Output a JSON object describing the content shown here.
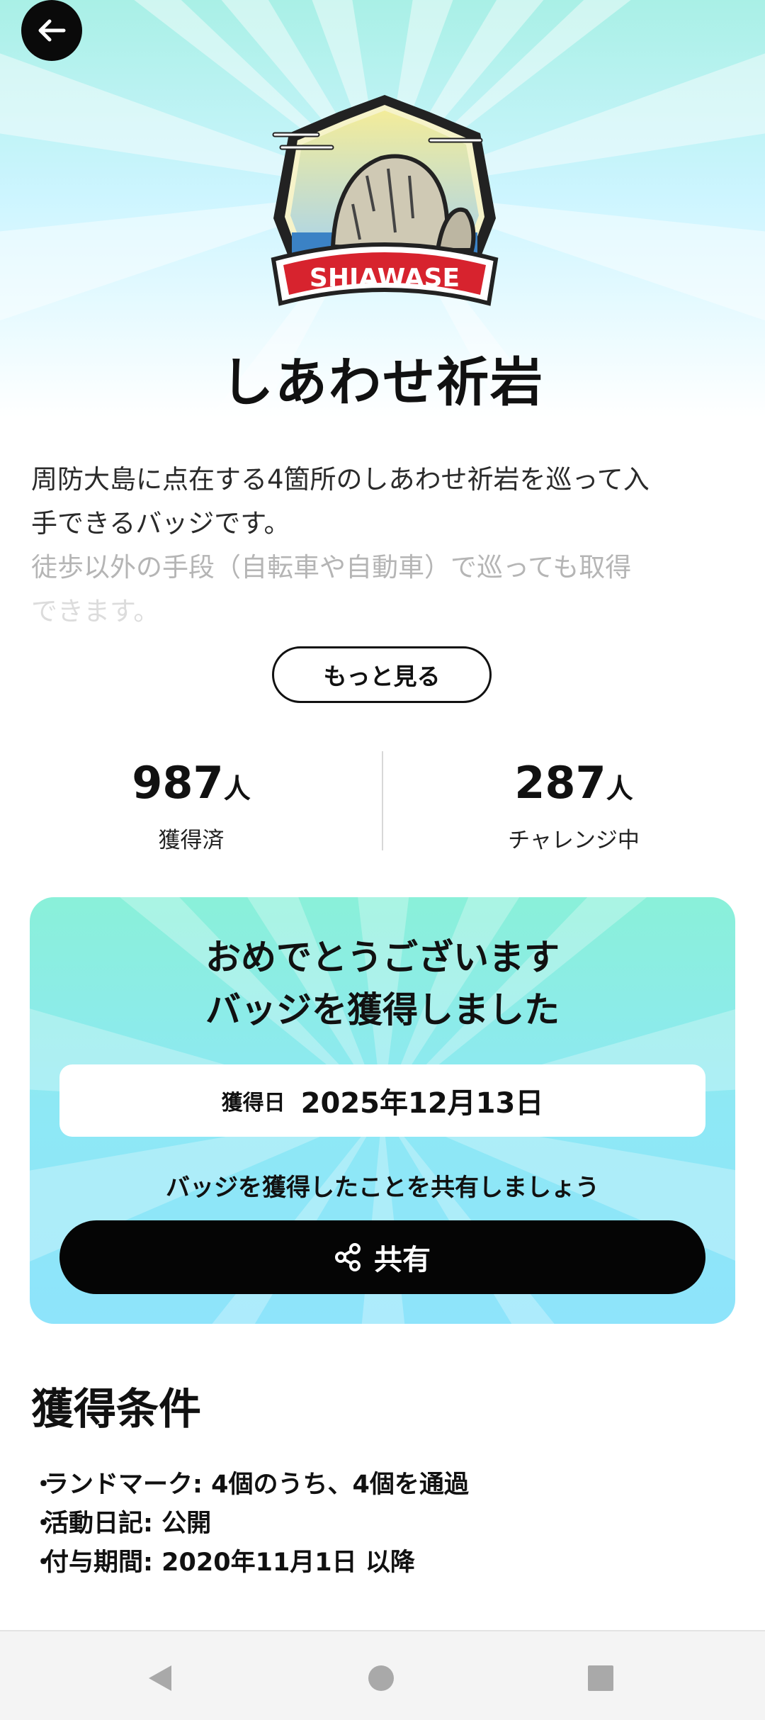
{
  "header": {
    "back_icon": "arrow-left-icon"
  },
  "badge": {
    "icon": "shiawase-rock-badge",
    "ribbon_text": "SHIAWASE",
    "colors": {
      "ribbon": "#d7232e",
      "frame": "#222222"
    }
  },
  "title": "しあわせ祈岩",
  "description": {
    "line1": "周防大島に点在する4箇所のしあわせ祈岩を巡って入",
    "line2": "手できるバッジです。",
    "line3": "徒歩以外の手段（自転車や自動車）で巡っても取得",
    "line4": "できます。"
  },
  "more_button": "もっと見る",
  "stats": {
    "acquired": {
      "value": "987",
      "unit": "人",
      "label": "獲得済"
    },
    "challenging": {
      "value": "287",
      "unit": "人",
      "label": "チャレンジ中"
    }
  },
  "card": {
    "congrats_line1": "おめでとうございます",
    "congrats_line2": "バッジを獲得しました",
    "date_label": "獲得日",
    "date_value": "2025年12月13日",
    "share_prompt": "バッジを獲得したことを共有しましょう",
    "share_label": "共有",
    "share_icon": "share-icon",
    "colors": {
      "top": "#8af0d9",
      "bottom": "#8ee4fb"
    }
  },
  "conditions": {
    "title": "獲得条件",
    "items": [
      "ランドマーク: 4個のうち、4個を通過",
      "活動日記: 公開",
      "付与期間: 2020年11月1日 以降"
    ]
  },
  "navbar": {
    "back": "nav-back-icon",
    "home": "nav-home-icon",
    "recents": "nav-recents-icon"
  }
}
